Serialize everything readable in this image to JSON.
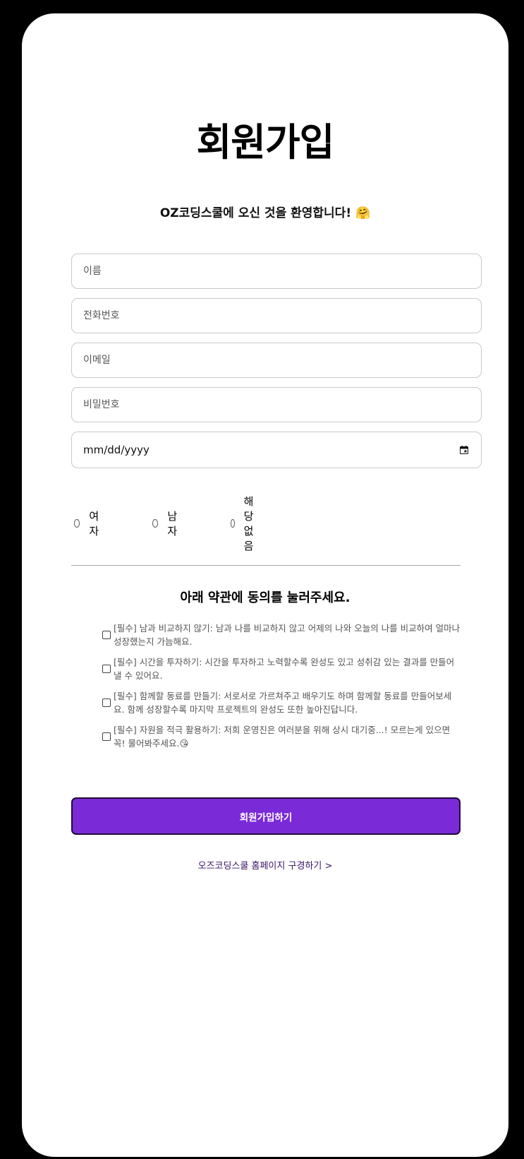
{
  "page": {
    "title": "회원가입",
    "welcome": "OZ코딩스쿨에 오신 것을 환영합니다! 🤗"
  },
  "form": {
    "name_placeholder": "이름",
    "phone_placeholder": "전화번호",
    "email_placeholder": "이메일",
    "password_placeholder": "비밀번호",
    "date_value": "mm/dd/yyyy",
    "gender_options": [
      {
        "label": "여자",
        "selected": false
      },
      {
        "label": "남자",
        "selected": false
      },
      {
        "label": "해당없음",
        "selected": false
      }
    ]
  },
  "terms": {
    "title": "아래 약관에 동의를 눌러주세요.",
    "items": [
      {
        "text": "[필수] 남과 비교하지 않기: 남과 나를 비교하지 않고 어제의 나와 오늘의 나를 비교하여 얼마나 성장했는지 가늠해요.",
        "checked": false
      },
      {
        "text": "[필수] 시간을 투자하기: 시간을 투자하고 노력할수록 완성도 있고 성취감 있는 결과를 만들어 낼 수 있어요.",
        "checked": false
      },
      {
        "text": "[필수] 함께할 동료를 만들기: 서로서로 가르쳐주고 배우기도 하며 함께할 동료를 만들어보세요. 함께 성장할수록 마지막 프로젝트의 완성도 또한 높아진답니다.",
        "checked": false
      },
      {
        "text": "[필수] 자원을 적극 활용하기: 저희 운영진은 여러분을 위해 상시 대기중...! 모르는게 있으면 꼭! 물어봐주세요.😘",
        "checked": false
      }
    ]
  },
  "actions": {
    "submit_label": "회원가입하기",
    "home_link_label": "오즈코딩스쿨 홈페이지 구경하기 >"
  },
  "colors": {
    "accent": "#7b2ad8",
    "link": "#3a1466",
    "background": "#000000",
    "card": "#ffffff"
  }
}
